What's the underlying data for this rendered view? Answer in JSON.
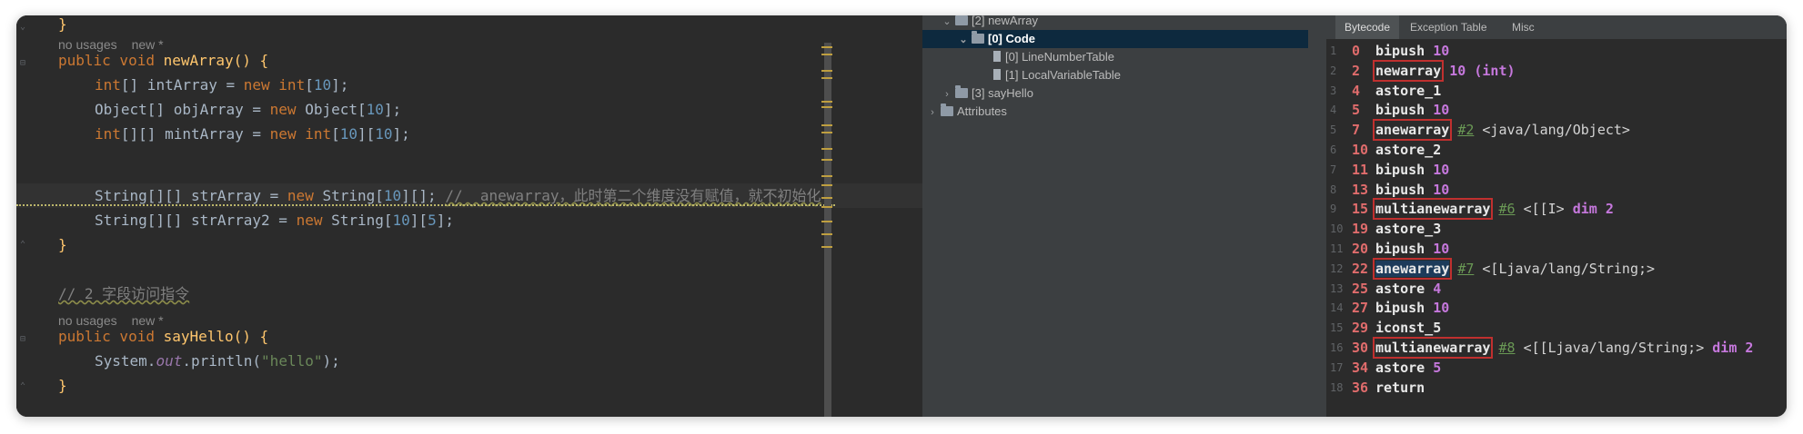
{
  "editor": {
    "hint1": {
      "usages": "no usages",
      "author": "new *"
    },
    "hint2": {
      "usages": "no usages",
      "author": "new *"
    },
    "lines": {
      "m1_sig_kw": "public void ",
      "m1_sig_name": "newArray",
      "m1_sig_rest": "() {",
      "l1_type": "int",
      "l1_rest": "[] intArray = ",
      "l1_new": "new ",
      "l1_type2": "int",
      "l1_open": "[",
      "l1_num": "10",
      "l1_close": "];",
      "l2_a": "Object[] objArray = ",
      "l2_new": "new ",
      "l2_b": "Object[",
      "l2_num": "10",
      "l2_c": "];",
      "l3_type": "int",
      "l3_a": "[][] mintArray = ",
      "l3_new": "new ",
      "l3_type2": "int",
      "l3_b": "[",
      "l3_num1": "10",
      "l3_c": "][",
      "l3_num2": "10",
      "l3_d": "];",
      "l4_a": "String[][] strArray = ",
      "l4_new": "new ",
      "l4_b": "String[",
      "l4_num": "10",
      "l4_c": "][]; ",
      "l4_comment": "//  anewarray，此时第二个维度没有赋值，就不初始化",
      "l5_a": "String[][] strArray2 = ",
      "l5_new": "new ",
      "l5_b": "String[",
      "l5_num1": "10",
      "l5_c": "][",
      "l5_num2": "5",
      "l5_d": "];",
      "close1": "}",
      "comment2": "// 2 字段访问指令",
      "m2_sig_kw": "public void ",
      "m2_sig_name": "sayHello",
      "m2_sig_rest": "() {",
      "l6_a": "System.",
      "l6_fld": "out",
      "l6_b": ".println(",
      "l6_str": "\"hello\"",
      "l6_c": ");",
      "close2": "}",
      "close0": "}"
    }
  },
  "structure": {
    "items": [
      {
        "label": "[2] newArray"
      },
      {
        "label": "[0] Code"
      },
      {
        "label": "[0] LineNumberTable"
      },
      {
        "label": "[1] LocalVariableTable"
      },
      {
        "label": "[3] sayHello"
      },
      {
        "label": "Attributes"
      }
    ]
  },
  "bytecode": {
    "tabs": [
      "Bytecode",
      "Exception Table",
      "Misc"
    ],
    "rows": [
      {
        "line": "1",
        "offset": "0",
        "instr": "bipush",
        "operand_num": "10",
        "ref": "",
        "text": ""
      },
      {
        "line": "2",
        "offset": "2",
        "instr": "newarray",
        "operand_num": "10 (int)",
        "ref": "",
        "text": ""
      },
      {
        "line": "3",
        "offset": "4",
        "instr": "astore_1",
        "operand_num": "",
        "ref": "",
        "text": ""
      },
      {
        "line": "4",
        "offset": "5",
        "instr": "bipush",
        "operand_num": "10",
        "ref": "",
        "text": ""
      },
      {
        "line": "5",
        "offset": "7",
        "instr": "anewarray",
        "operand_num": "",
        "ref": "#2",
        "text": "<java/lang/Object>"
      },
      {
        "line": "6",
        "offset": "10",
        "instr": "astore_2",
        "operand_num": "",
        "ref": "",
        "text": ""
      },
      {
        "line": "7",
        "offset": "11",
        "instr": "bipush",
        "operand_num": "10",
        "ref": "",
        "text": ""
      },
      {
        "line": "8",
        "offset": "13",
        "instr": "bipush",
        "operand_num": "10",
        "ref": "",
        "text": ""
      },
      {
        "line": "9",
        "offset": "15",
        "instr": "multianewarray",
        "operand_num": "",
        "ref": "#6",
        "text": "<[[I> ",
        "tail": "dim 2"
      },
      {
        "line": "10",
        "offset": "19",
        "instr": "astore_3",
        "operand_num": "",
        "ref": "",
        "text": ""
      },
      {
        "line": "11",
        "offset": "20",
        "instr": "bipush",
        "operand_num": "10",
        "ref": "",
        "text": ""
      },
      {
        "line": "12",
        "offset": "22",
        "instr": "anewarray",
        "operand_num": "",
        "ref": "#7",
        "text": "<[Ljava/lang/String;>"
      },
      {
        "line": "13",
        "offset": "25",
        "instr": "astore",
        "operand_num": "4",
        "ref": "",
        "text": ""
      },
      {
        "line": "14",
        "offset": "27",
        "instr": "bipush",
        "operand_num": "10",
        "ref": "",
        "text": ""
      },
      {
        "line": "15",
        "offset": "29",
        "instr": "iconst_5",
        "operand_num": "",
        "ref": "",
        "text": ""
      },
      {
        "line": "16",
        "offset": "30",
        "instr": "multianewarray",
        "operand_num": "",
        "ref": "#8",
        "text": "<[[Ljava/lang/String;> ",
        "tail": "dim 2"
      },
      {
        "line": "17",
        "offset": "34",
        "instr": "astore",
        "operand_num": "5",
        "ref": "",
        "text": ""
      },
      {
        "line": "18",
        "offset": "36",
        "instr": "return",
        "operand_num": "",
        "ref": "",
        "text": ""
      }
    ]
  },
  "colors": {
    "editor_bg": "#2b2b2b",
    "keyword": "#cc7832",
    "number": "#6897bb",
    "string": "#6a8759",
    "highlight_box": "#c0302f",
    "selection": "#0d293e"
  }
}
